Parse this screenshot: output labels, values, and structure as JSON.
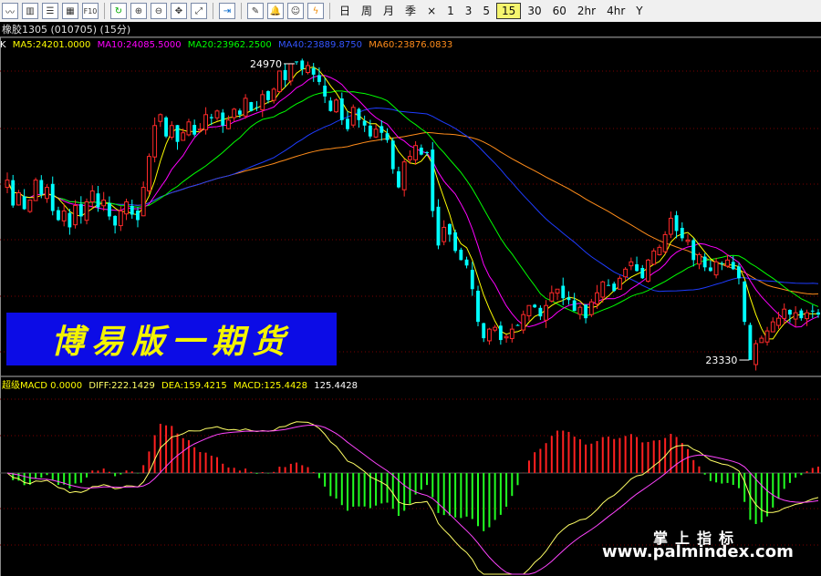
{
  "toolbar": {
    "icons": [
      "line-chart-icon",
      "bar-chart-icon",
      "table-icon",
      "grid-icon",
      "f10-icon",
      "refresh-icon",
      "zoom-in-icon",
      "zoom-out-icon",
      "cursor-icon",
      "restore-icon",
      "export-icon",
      "edit-icon",
      "alarm-icon",
      "users-icon",
      "lightning-icon"
    ],
    "f10_label": "F10",
    "periods": [
      "日",
      "周",
      "月",
      "季",
      "×",
      "1",
      "3",
      "5",
      "15",
      "30",
      "60",
      "2hr",
      "4hr",
      "Y"
    ],
    "active_period": "15"
  },
  "title": "橡胶1305 (010705) (15分)",
  "ma_row": {
    "k": "K",
    "ma5": "MA5:24201.0000",
    "ma10": "MA10:24085.5000",
    "ma20": "MA20:23962.2500",
    "ma40": "MA40:23889.8750",
    "ma60": "MA60:23876.0833"
  },
  "banner": "博易版一期货",
  "macd_row": {
    "name": "超级MACD 0.0000",
    "diff": "DIFF:222.1429",
    "dea": "DEA:159.4215",
    "macd": "MACD:125.4428",
    "extra": "125.4428"
  },
  "watermark": {
    "line1": "掌上指标",
    "line2": "www.palmindex.com"
  },
  "colors": {
    "up": "#ff2a2a",
    "down": "#00ffff",
    "ma5": "#ffff00",
    "ma10": "#ff00ff",
    "ma20": "#00ff00",
    "ma40": "#1e3cff",
    "ma60": "#ff8c1a",
    "diff": "#ffff66",
    "dea": "#ff44ff",
    "macd_pos": "#ff2020",
    "macd_neg": "#22ff22"
  },
  "chart_data": [
    {
      "type": "candlestick",
      "title": "",
      "high_label": "24970",
      "low_label": "23330",
      "ylim": [
        23280,
        25050
      ],
      "closes": [
        24320,
        24180,
        24250,
        24160,
        24210,
        24320,
        24240,
        24280,
        24150,
        24100,
        24150,
        24060,
        24180,
        24120,
        24200,
        24260,
        24170,
        24210,
        24120,
        24070,
        24150,
        24200,
        24130,
        24100,
        24280,
        24450,
        24620,
        24680,
        24560,
        24620,
        24530,
        24580,
        24640,
        24570,
        24600,
        24680,
        24660,
        24700,
        24620,
        24650,
        24710,
        24680,
        24770,
        24700,
        24720,
        24790,
        24760,
        24820,
        24920,
        24870,
        24960,
        24970,
        24930,
        24950,
        24900,
        24860,
        24780,
        24700,
        24760,
        24650,
        24600,
        24720,
        24650,
        24620,
        24560,
        24600,
        24580,
        24540,
        24380,
        24280,
        24420,
        24450,
        24510,
        24460,
        24470,
        24150,
        23960,
        24060,
        24020,
        23930,
        23880,
        23850,
        23720,
        23540,
        23450,
        23500,
        23510,
        23440,
        23460,
        23500,
        23520,
        23580,
        23630,
        23620,
        23570,
        23630,
        23700,
        23720,
        23670,
        23660,
        23600,
        23620,
        23560,
        23650,
        23700,
        23760,
        23740,
        23710,
        23780,
        23830,
        23870,
        23820,
        23780,
        23880,
        23930,
        23950,
        24020,
        24110,
        24040,
        24000,
        23990,
        23880,
        23910,
        23840,
        23820,
        23870,
        23860,
        23880,
        23830,
        23780,
        23540,
        23330,
        23420,
        23450,
        23490,
        23540,
        23560,
        23610,
        23580,
        23590,
        23560,
        23590,
        23600,
        23580
      ]
    },
    {
      "type": "bar",
      "title": "",
      "series_name": "MACD",
      "ylim": [
        -280,
        180
      ],
      "note": "MACD histogram (red above zero, green below); DIFF and DEA lines overlaid"
    }
  ]
}
